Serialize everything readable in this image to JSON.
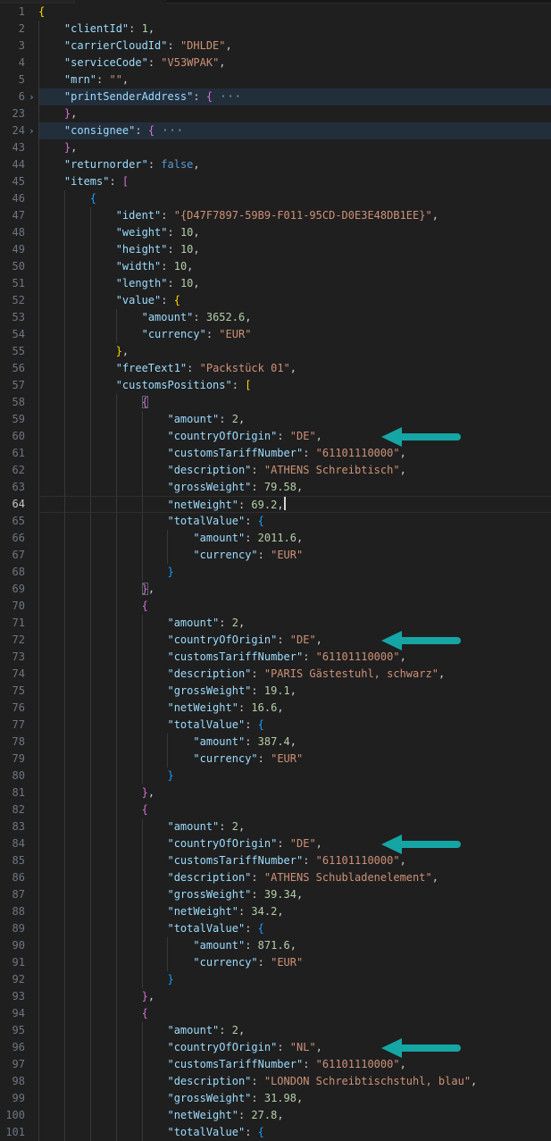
{
  "colors": {
    "background": "#1f1f1f",
    "fold_highlight": "#232e3b",
    "arrow_accent": "#16a5a5",
    "current_line_border": "#2e2e2e"
  },
  "editor": {
    "language": "json",
    "cursor_line": 64,
    "folded_lines": [
      6,
      24
    ],
    "arrow_lines": [
      60,
      72,
      84,
      96
    ],
    "fold_ellipsis": " ···",
    "chevron_glyph": "›",
    "lines": [
      {
        "n": 1,
        "i": 0,
        "t": [
          [
            "g",
            "{"
          ]
        ]
      },
      {
        "n": 2,
        "i": 1,
        "t": [
          [
            "k",
            "\"clientId\""
          ],
          [
            "p",
            ": "
          ],
          [
            "n",
            "1"
          ],
          [
            "p",
            ","
          ]
        ]
      },
      {
        "n": 3,
        "i": 1,
        "t": [
          [
            "k",
            "\"carrierCloudId\""
          ],
          [
            "p",
            ": "
          ],
          [
            "s",
            "\"DHLDE\""
          ],
          [
            "p",
            ","
          ]
        ]
      },
      {
        "n": 4,
        "i": 1,
        "t": [
          [
            "k",
            "\"serviceCode\""
          ],
          [
            "p",
            ": "
          ],
          [
            "s",
            "\"V53WPAK\""
          ],
          [
            "p",
            ","
          ]
        ]
      },
      {
        "n": 5,
        "i": 1,
        "t": [
          [
            "k",
            "\"mrn\""
          ],
          [
            "p",
            ": "
          ],
          [
            "s",
            "\"\""
          ],
          [
            "p",
            ","
          ]
        ]
      },
      {
        "n": 6,
        "i": 1,
        "chev": true,
        "fold": true,
        "t": [
          [
            "k",
            "\"printSenderAddress\""
          ],
          [
            "p",
            ": "
          ],
          [
            "m",
            "{"
          ],
          [
            "e",
            " ···"
          ]
        ]
      },
      {
        "n": 23,
        "i": 1,
        "t": [
          [
            "m",
            "}"
          ],
          [
            "p",
            ","
          ]
        ]
      },
      {
        "n": 24,
        "i": 1,
        "chev": true,
        "fold": true,
        "t": [
          [
            "k",
            "\"consignee\""
          ],
          [
            "p",
            ": "
          ],
          [
            "m",
            "{"
          ],
          [
            "e",
            " ···"
          ]
        ]
      },
      {
        "n": 43,
        "i": 1,
        "t": [
          [
            "m",
            "}"
          ],
          [
            "p",
            ","
          ]
        ]
      },
      {
        "n": 44,
        "i": 1,
        "t": [
          [
            "k",
            "\"returnorder\""
          ],
          [
            "p",
            ": "
          ],
          [
            "kw",
            "false"
          ],
          [
            "p",
            ","
          ]
        ]
      },
      {
        "n": 45,
        "i": 1,
        "t": [
          [
            "k",
            "\"items\""
          ],
          [
            "p",
            ": "
          ],
          [
            "m",
            "["
          ]
        ]
      },
      {
        "n": 46,
        "i": 2,
        "t": [
          [
            "b",
            "{"
          ]
        ]
      },
      {
        "n": 47,
        "i": 3,
        "t": [
          [
            "k",
            "\"ident\""
          ],
          [
            "p",
            ": "
          ],
          [
            "s",
            "\"{D47F7897-59B9-F011-95CD-D0E3E48DB1EE}\""
          ],
          [
            "p",
            ","
          ]
        ]
      },
      {
        "n": 48,
        "i": 3,
        "t": [
          [
            "k",
            "\"weight\""
          ],
          [
            "p",
            ": "
          ],
          [
            "n",
            "10"
          ],
          [
            "p",
            ","
          ]
        ]
      },
      {
        "n": 49,
        "i": 3,
        "t": [
          [
            "k",
            "\"height\""
          ],
          [
            "p",
            ": "
          ],
          [
            "n",
            "10"
          ],
          [
            "p",
            ","
          ]
        ]
      },
      {
        "n": 50,
        "i": 3,
        "t": [
          [
            "k",
            "\"width\""
          ],
          [
            "p",
            ": "
          ],
          [
            "n",
            "10"
          ],
          [
            "p",
            ","
          ]
        ]
      },
      {
        "n": 51,
        "i": 3,
        "t": [
          [
            "k",
            "\"length\""
          ],
          [
            "p",
            ": "
          ],
          [
            "n",
            "10"
          ],
          [
            "p",
            ","
          ]
        ]
      },
      {
        "n": 52,
        "i": 3,
        "t": [
          [
            "k",
            "\"value\""
          ],
          [
            "p",
            ": "
          ],
          [
            "g",
            "{"
          ]
        ]
      },
      {
        "n": 53,
        "i": 4,
        "t": [
          [
            "k",
            "\"amount\""
          ],
          [
            "p",
            ": "
          ],
          [
            "n",
            "3652.6"
          ],
          [
            "p",
            ","
          ]
        ]
      },
      {
        "n": 54,
        "i": 4,
        "t": [
          [
            "k",
            "\"currency\""
          ],
          [
            "p",
            ": "
          ],
          [
            "s",
            "\"EUR\""
          ]
        ]
      },
      {
        "n": 55,
        "i": 3,
        "t": [
          [
            "g",
            "}"
          ],
          [
            "p",
            ","
          ]
        ]
      },
      {
        "n": 56,
        "i": 3,
        "t": [
          [
            "k",
            "\"freeText1\""
          ],
          [
            "p",
            ": "
          ],
          [
            "s",
            "\"Packstück 01\""
          ],
          [
            "p",
            ","
          ]
        ]
      },
      {
        "n": 57,
        "i": 3,
        "t": [
          [
            "k",
            "\"customsPositions\""
          ],
          [
            "p",
            ": "
          ],
          [
            "g",
            "["
          ]
        ]
      },
      {
        "n": 58,
        "i": 4,
        "t": [
          [
            "m box",
            "{"
          ]
        ]
      },
      {
        "n": 59,
        "i": 5,
        "t": [
          [
            "k",
            "\"amount\""
          ],
          [
            "p",
            ": "
          ],
          [
            "n",
            "2"
          ],
          [
            "p",
            ","
          ]
        ]
      },
      {
        "n": 60,
        "i": 5,
        "arrow": true,
        "t": [
          [
            "k",
            "\"countryOfOrigin\""
          ],
          [
            "p",
            ": "
          ],
          [
            "s",
            "\"DE\""
          ],
          [
            "p",
            ","
          ]
        ]
      },
      {
        "n": 61,
        "i": 5,
        "t": [
          [
            "k",
            "\"customsTariffNumber\""
          ],
          [
            "p",
            ": "
          ],
          [
            "s",
            "\"61101110000\""
          ],
          [
            "p",
            ","
          ]
        ]
      },
      {
        "n": 62,
        "i": 5,
        "t": [
          [
            "k",
            "\"description\""
          ],
          [
            "p",
            ": "
          ],
          [
            "s",
            "\"ATHENS Schreibtisch\""
          ],
          [
            "p",
            ","
          ]
        ]
      },
      {
        "n": 63,
        "i": 5,
        "t": [
          [
            "k",
            "\"grossWeight\""
          ],
          [
            "p",
            ": "
          ],
          [
            "n",
            "79.58"
          ],
          [
            "p",
            ","
          ]
        ]
      },
      {
        "n": 64,
        "i": 5,
        "cur": true,
        "caret": true,
        "t": [
          [
            "k",
            "\"netWeight\""
          ],
          [
            "p",
            ": "
          ],
          [
            "n",
            "69.2"
          ],
          [
            "p",
            ","
          ]
        ]
      },
      {
        "n": 65,
        "i": 5,
        "t": [
          [
            "k",
            "\"totalValue\""
          ],
          [
            "p",
            ": "
          ],
          [
            "b",
            "{"
          ]
        ]
      },
      {
        "n": 66,
        "i": 6,
        "t": [
          [
            "k",
            "\"amount\""
          ],
          [
            "p",
            ": "
          ],
          [
            "n",
            "2011.6"
          ],
          [
            "p",
            ","
          ]
        ]
      },
      {
        "n": 67,
        "i": 6,
        "t": [
          [
            "k",
            "\"currency\""
          ],
          [
            "p",
            ": "
          ],
          [
            "s",
            "\"EUR\""
          ]
        ]
      },
      {
        "n": 68,
        "i": 5,
        "t": [
          [
            "b",
            "}"
          ]
        ]
      },
      {
        "n": 69,
        "i": 4,
        "t": [
          [
            "m box",
            "}"
          ],
          [
            "p",
            ","
          ]
        ]
      },
      {
        "n": 70,
        "i": 4,
        "t": [
          [
            "m",
            "{"
          ]
        ]
      },
      {
        "n": 71,
        "i": 5,
        "t": [
          [
            "k",
            "\"amount\""
          ],
          [
            "p",
            ": "
          ],
          [
            "n",
            "2"
          ],
          [
            "p",
            ","
          ]
        ]
      },
      {
        "n": 72,
        "i": 5,
        "arrow": true,
        "t": [
          [
            "k",
            "\"countryOfOrigin\""
          ],
          [
            "p",
            ": "
          ],
          [
            "s",
            "\"DE\""
          ],
          [
            "p",
            ","
          ]
        ]
      },
      {
        "n": 73,
        "i": 5,
        "t": [
          [
            "k",
            "\"customsTariffNumber\""
          ],
          [
            "p",
            ": "
          ],
          [
            "s",
            "\"61101110000\""
          ],
          [
            "p",
            ","
          ]
        ]
      },
      {
        "n": 74,
        "i": 5,
        "t": [
          [
            "k",
            "\"description\""
          ],
          [
            "p",
            ": "
          ],
          [
            "s",
            "\"PARIS Gästestuhl, schwarz\""
          ],
          [
            "p",
            ","
          ]
        ]
      },
      {
        "n": 75,
        "i": 5,
        "t": [
          [
            "k",
            "\"grossWeight\""
          ],
          [
            "p",
            ": "
          ],
          [
            "n",
            "19.1"
          ],
          [
            "p",
            ","
          ]
        ]
      },
      {
        "n": 76,
        "i": 5,
        "t": [
          [
            "k",
            "\"netWeight\""
          ],
          [
            "p",
            ": "
          ],
          [
            "n",
            "16.6"
          ],
          [
            "p",
            ","
          ]
        ]
      },
      {
        "n": 77,
        "i": 5,
        "t": [
          [
            "k",
            "\"totalValue\""
          ],
          [
            "p",
            ": "
          ],
          [
            "b",
            "{"
          ]
        ]
      },
      {
        "n": 78,
        "i": 6,
        "t": [
          [
            "k",
            "\"amount\""
          ],
          [
            "p",
            ": "
          ],
          [
            "n",
            "387.4"
          ],
          [
            "p",
            ","
          ]
        ]
      },
      {
        "n": 79,
        "i": 6,
        "t": [
          [
            "k",
            "\"currency\""
          ],
          [
            "p",
            ": "
          ],
          [
            "s",
            "\"EUR\""
          ]
        ]
      },
      {
        "n": 80,
        "i": 5,
        "t": [
          [
            "b",
            "}"
          ]
        ]
      },
      {
        "n": 81,
        "i": 4,
        "t": [
          [
            "m",
            "}"
          ],
          [
            "p",
            ","
          ]
        ]
      },
      {
        "n": 82,
        "i": 4,
        "t": [
          [
            "m",
            "{"
          ]
        ]
      },
      {
        "n": 83,
        "i": 5,
        "t": [
          [
            "k",
            "\"amount\""
          ],
          [
            "p",
            ": "
          ],
          [
            "n",
            "2"
          ],
          [
            "p",
            ","
          ]
        ]
      },
      {
        "n": 84,
        "i": 5,
        "arrow": true,
        "t": [
          [
            "k",
            "\"countryOfOrigin\""
          ],
          [
            "p",
            ": "
          ],
          [
            "s",
            "\"DE\""
          ],
          [
            "p",
            ","
          ]
        ]
      },
      {
        "n": 85,
        "i": 5,
        "t": [
          [
            "k",
            "\"customsTariffNumber\""
          ],
          [
            "p",
            ": "
          ],
          [
            "s",
            "\"61101110000\""
          ],
          [
            "p",
            ","
          ]
        ]
      },
      {
        "n": 86,
        "i": 5,
        "t": [
          [
            "k",
            "\"description\""
          ],
          [
            "p",
            ": "
          ],
          [
            "s",
            "\"ATHENS Schubladenelement\""
          ],
          [
            "p",
            ","
          ]
        ]
      },
      {
        "n": 87,
        "i": 5,
        "t": [
          [
            "k",
            "\"grossWeight\""
          ],
          [
            "p",
            ": "
          ],
          [
            "n",
            "39.34"
          ],
          [
            "p",
            ","
          ]
        ]
      },
      {
        "n": 88,
        "i": 5,
        "t": [
          [
            "k",
            "\"netWeight\""
          ],
          [
            "p",
            ": "
          ],
          [
            "n",
            "34.2"
          ],
          [
            "p",
            ","
          ]
        ]
      },
      {
        "n": 89,
        "i": 5,
        "t": [
          [
            "k",
            "\"totalValue\""
          ],
          [
            "p",
            ": "
          ],
          [
            "b",
            "{"
          ]
        ]
      },
      {
        "n": 90,
        "i": 6,
        "t": [
          [
            "k",
            "\"amount\""
          ],
          [
            "p",
            ": "
          ],
          [
            "n",
            "871.6"
          ],
          [
            "p",
            ","
          ]
        ]
      },
      {
        "n": 91,
        "i": 6,
        "t": [
          [
            "k",
            "\"currency\""
          ],
          [
            "p",
            ": "
          ],
          [
            "s",
            "\"EUR\""
          ]
        ]
      },
      {
        "n": 92,
        "i": 5,
        "t": [
          [
            "b",
            "}"
          ]
        ]
      },
      {
        "n": 93,
        "i": 4,
        "t": [
          [
            "m",
            "}"
          ],
          [
            "p",
            ","
          ]
        ]
      },
      {
        "n": 94,
        "i": 4,
        "t": [
          [
            "m",
            "{"
          ]
        ]
      },
      {
        "n": 95,
        "i": 5,
        "t": [
          [
            "k",
            "\"amount\""
          ],
          [
            "p",
            ": "
          ],
          [
            "n",
            "2"
          ],
          [
            "p",
            ","
          ]
        ]
      },
      {
        "n": 96,
        "i": 5,
        "arrow": true,
        "t": [
          [
            "k",
            "\"countryOfOrigin\""
          ],
          [
            "p",
            ": "
          ],
          [
            "s",
            "\"NL\""
          ],
          [
            "p",
            ","
          ]
        ]
      },
      {
        "n": 97,
        "i": 5,
        "t": [
          [
            "k",
            "\"customsTariffNumber\""
          ],
          [
            "p",
            ": "
          ],
          [
            "s",
            "\"61101110000\""
          ],
          [
            "p",
            ","
          ]
        ]
      },
      {
        "n": 98,
        "i": 5,
        "t": [
          [
            "k",
            "\"description\""
          ],
          [
            "p",
            ": "
          ],
          [
            "s",
            "\"LONDON Schreibtischstuhl, blau\""
          ],
          [
            "p",
            ","
          ]
        ]
      },
      {
        "n": 99,
        "i": 5,
        "t": [
          [
            "k",
            "\"grossWeight\""
          ],
          [
            "p",
            ": "
          ],
          [
            "n",
            "31.98"
          ],
          [
            "p",
            ","
          ]
        ]
      },
      {
        "n": 100,
        "i": 5,
        "t": [
          [
            "k",
            "\"netWeight\""
          ],
          [
            "p",
            ": "
          ],
          [
            "n",
            "27.8"
          ],
          [
            "p",
            ","
          ]
        ]
      },
      {
        "n": 101,
        "i": 5,
        "t": [
          [
            "k",
            "\"totalValue\""
          ],
          [
            "p",
            ": "
          ],
          [
            "b",
            "{"
          ]
        ]
      }
    ]
  }
}
